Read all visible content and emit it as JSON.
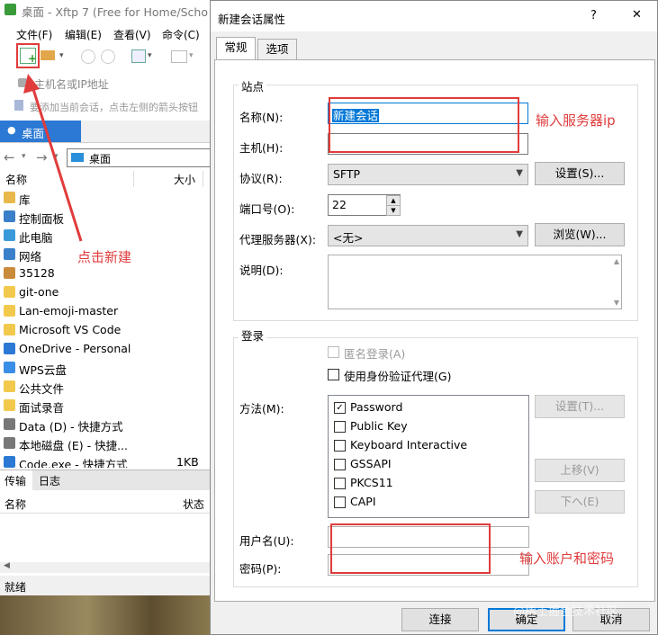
{
  "xftp": {
    "title": "桌面 - Xftp 7 (Free for Home/Scho",
    "menu": [
      "文件(F)",
      "编辑(E)",
      "查看(V)",
      "命令(C)"
    ],
    "address_placeholder": "主机名或IP地址",
    "hint": "要添加当前会话，点击左侧的箭头按钮",
    "tab_label": "桌面",
    "nav_path": "桌面",
    "col_name": "名称",
    "col_size": "大小",
    "files": [
      {
        "name": "库",
        "size": "",
        "icon": "library-icon",
        "color": "#e8b84a"
      },
      {
        "name": "控制面板",
        "size": "",
        "icon": "control-panel-icon",
        "color": "#3a7fc9"
      },
      {
        "name": "此电脑",
        "size": "",
        "icon": "computer-icon",
        "color": "#3a9ad9"
      },
      {
        "name": "网络",
        "size": "",
        "icon": "network-icon",
        "color": "#3a7fc9"
      },
      {
        "name": "35128",
        "size": "",
        "icon": "user-icon",
        "color": "#c98a3a"
      },
      {
        "name": "git-one",
        "size": "",
        "icon": "folder-icon",
        "color": "#f2c94c"
      },
      {
        "name": "Lan-emoji-master",
        "size": "",
        "icon": "folder-icon",
        "color": "#f2c94c"
      },
      {
        "name": "Microsoft VS Code",
        "size": "",
        "icon": "folder-icon",
        "color": "#f2c94c"
      },
      {
        "name": "OneDrive - Personal",
        "size": "",
        "icon": "onedrive-icon",
        "color": "#2b79d4"
      },
      {
        "name": "WPS云盘",
        "size": "",
        "icon": "cloud-icon",
        "color": "#3a8ee6"
      },
      {
        "name": "公共文件",
        "size": "",
        "icon": "folder-icon",
        "color": "#f2c94c"
      },
      {
        "name": "面试录音",
        "size": "",
        "icon": "folder-icon",
        "color": "#f2c94c"
      },
      {
        "name": "Data (D) - 快捷方式",
        "size": "",
        "icon": "drive-icon",
        "color": "#777777"
      },
      {
        "name": "本地磁盘 (E) - 快捷...",
        "size": "",
        "icon": "drive-icon",
        "color": "#777777"
      },
      {
        "name": "Code.exe - 快捷方式",
        "size": "1KB",
        "icon": "shortcut-icon",
        "color": "#2b79d4"
      }
    ],
    "lower_tabs": [
      "传输",
      "日志"
    ],
    "lower_col_name": "名称",
    "lower_col_status": "状态",
    "status": "就绪"
  },
  "dialog": {
    "title": "新建会话属性",
    "help": "?",
    "close": "✕",
    "tabs": [
      "常规",
      "选项"
    ],
    "site_group": "站点",
    "name_label": "名称(N):",
    "name_value": "新建会话",
    "host_label": "主机(H):",
    "host_value": "",
    "protocol_label": "协议(R):",
    "protocol_value": "SFTP",
    "settings_button": "设置(S)...",
    "port_label": "端口号(O):",
    "port_value": "22",
    "proxy_label": "代理服务器(X):",
    "proxy_value": "<无>",
    "browse_button": "浏览(W)...",
    "desc_label": "说明(D):",
    "login_group": "登录",
    "anonymous_label": "匿名登录(A)",
    "agent_label": "使用身份验证代理(G)",
    "method_label": "方法(M):",
    "methods": [
      {
        "label": "Password",
        "checked": true
      },
      {
        "label": "Public Key",
        "checked": false
      },
      {
        "label": "Keyboard Interactive",
        "checked": false
      },
      {
        "label": "GSSAPI",
        "checked": false
      },
      {
        "label": "PKCS11",
        "checked": false
      },
      {
        "label": "CAPI",
        "checked": false
      }
    ],
    "method_settings_button": "设置(T)...",
    "up_button": "上移(V)",
    "down_button": "下へ(E)",
    "username_label": "用户名(U):",
    "password_label": "密码(P):",
    "connect_button": "连接",
    "ok_button": "确定",
    "cancel_button": "取消"
  },
  "annotations": {
    "new_session": "点击新建",
    "server_ip": "输入服务器ip",
    "account": "输入账户和密码",
    "color": "#e03c3c"
  },
  "watermark": "@稀土掘金技术社区"
}
